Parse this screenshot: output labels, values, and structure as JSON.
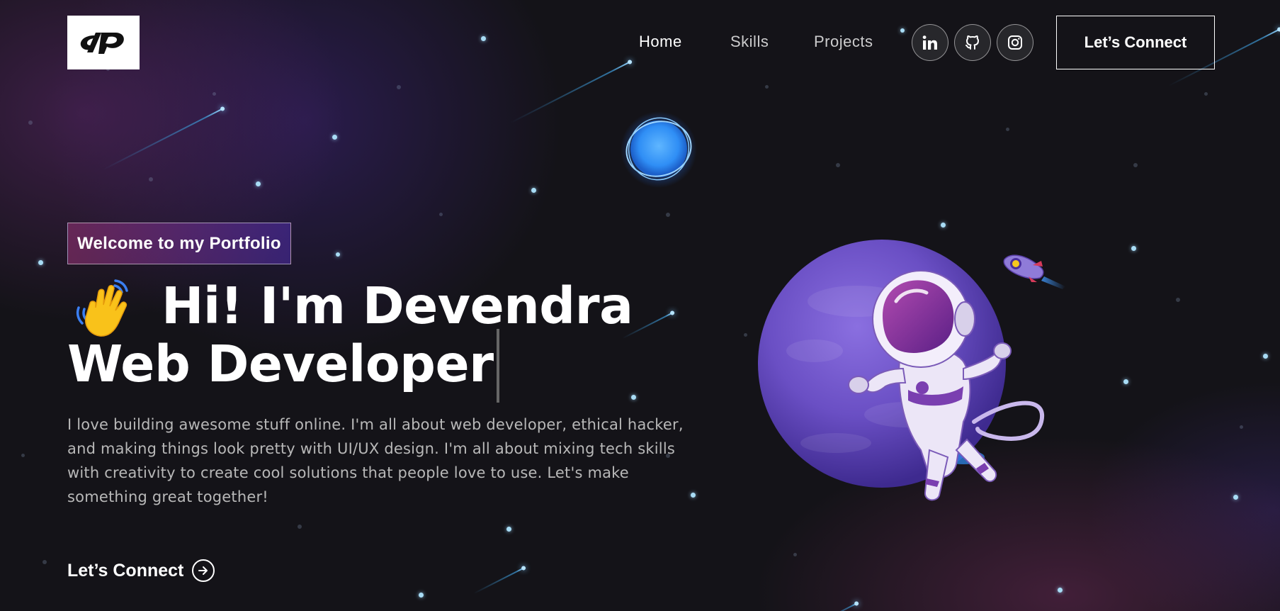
{
  "nav": {
    "logo_text": "dp",
    "links": [
      {
        "label": "Home",
        "active": true
      },
      {
        "label": "Skills",
        "active": false
      },
      {
        "label": "Projects",
        "active": false
      }
    ],
    "socials": [
      {
        "name": "linkedin-icon",
        "label": "in"
      },
      {
        "name": "github-icon"
      },
      {
        "name": "instagram-icon"
      }
    ],
    "cta_label": "Let’s Connect"
  },
  "hero": {
    "tagline": "Welcome to my Portfolio",
    "greeting": "Hi! I'm Devendra",
    "role": "Web Developer",
    "description": "I love building awesome stuff online. I'm all about web developer, ethical hacker, and making things look pretty with UI/UX design. I'm all about mixing tech skills with creativity to create cool solutions that people love to use. Let's make something great together!",
    "cta_label": "Let’s Connect"
  },
  "colors": {
    "background": "#121212",
    "tagline_gradient_start": "#aa367c",
    "tagline_gradient_end": "#4a2fbd",
    "star": "#a8dcf5",
    "planet": "#6a4fc4"
  },
  "icons": [
    "wave-hand-icon",
    "arrow-right-circle-icon",
    "linkedin-icon",
    "github-icon",
    "instagram-icon",
    "rocket-icon",
    "astronaut-illustration",
    "glowing-planet-icon"
  ]
}
